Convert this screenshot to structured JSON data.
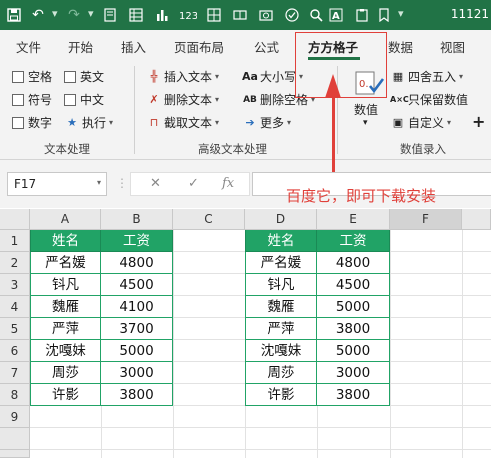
{
  "titlebar": {
    "right_text": "11121"
  },
  "tabs": [
    "文件",
    "开始",
    "插入",
    "页面布局",
    "公式",
    "方方格子",
    "数据",
    "视图"
  ],
  "ribbon": {
    "text_group": {
      "checkboxes": [
        "空格",
        "英文",
        "符号",
        "中文",
        "数字"
      ],
      "execute": "执行",
      "label": "文本处理"
    },
    "advanced_group": {
      "insert_text": "插入文本",
      "delete_text": "删除文本",
      "extract_text": "截取文本",
      "case": "大小写",
      "delete_spaces": "删除空格",
      "more": "更多",
      "label": "高级文本处理"
    },
    "number_group": {
      "number_btn": "数值",
      "round": "四舍五入",
      "keep_numbers": "只保留数值",
      "custom": "自定义",
      "label": "数值录入"
    }
  },
  "formula_bar": {
    "name_box": "F17",
    "cancel": "✕",
    "confirm": "✓",
    "fx": "fx"
  },
  "annotation": "百度它，即可下载安装",
  "grid": {
    "columns": [
      "A",
      "B",
      "C",
      "D",
      "E",
      "F"
    ],
    "rows": [
      "1",
      "2",
      "3",
      "4",
      "5",
      "6",
      "7",
      "8",
      "9"
    ],
    "left_table": {
      "headers": [
        "姓名",
        "工资"
      ],
      "rows": [
        [
          "严名媛",
          "4800"
        ],
        [
          "钭凡",
          "4500"
        ],
        [
          "魏雁",
          "4100"
        ],
        [
          "严萍",
          "3700"
        ],
        [
          "沈嘎妹",
          "5000"
        ],
        [
          "周莎",
          "3000"
        ],
        [
          "许影",
          "3800"
        ]
      ]
    },
    "right_table": {
      "headers": [
        "姓名",
        "工资"
      ],
      "rows": [
        [
          "严名媛",
          "4800"
        ],
        [
          "钭凡",
          "4500"
        ],
        [
          "魏雁",
          "5000"
        ],
        [
          "严萍",
          "3800"
        ],
        [
          "沈嘎妹",
          "5000"
        ],
        [
          "周莎",
          "3000"
        ],
        [
          "许影",
          "3800"
        ]
      ]
    }
  },
  "colors": {
    "accent": "#217346",
    "table_header": "#21a366",
    "annotation": "#e0403a"
  }
}
